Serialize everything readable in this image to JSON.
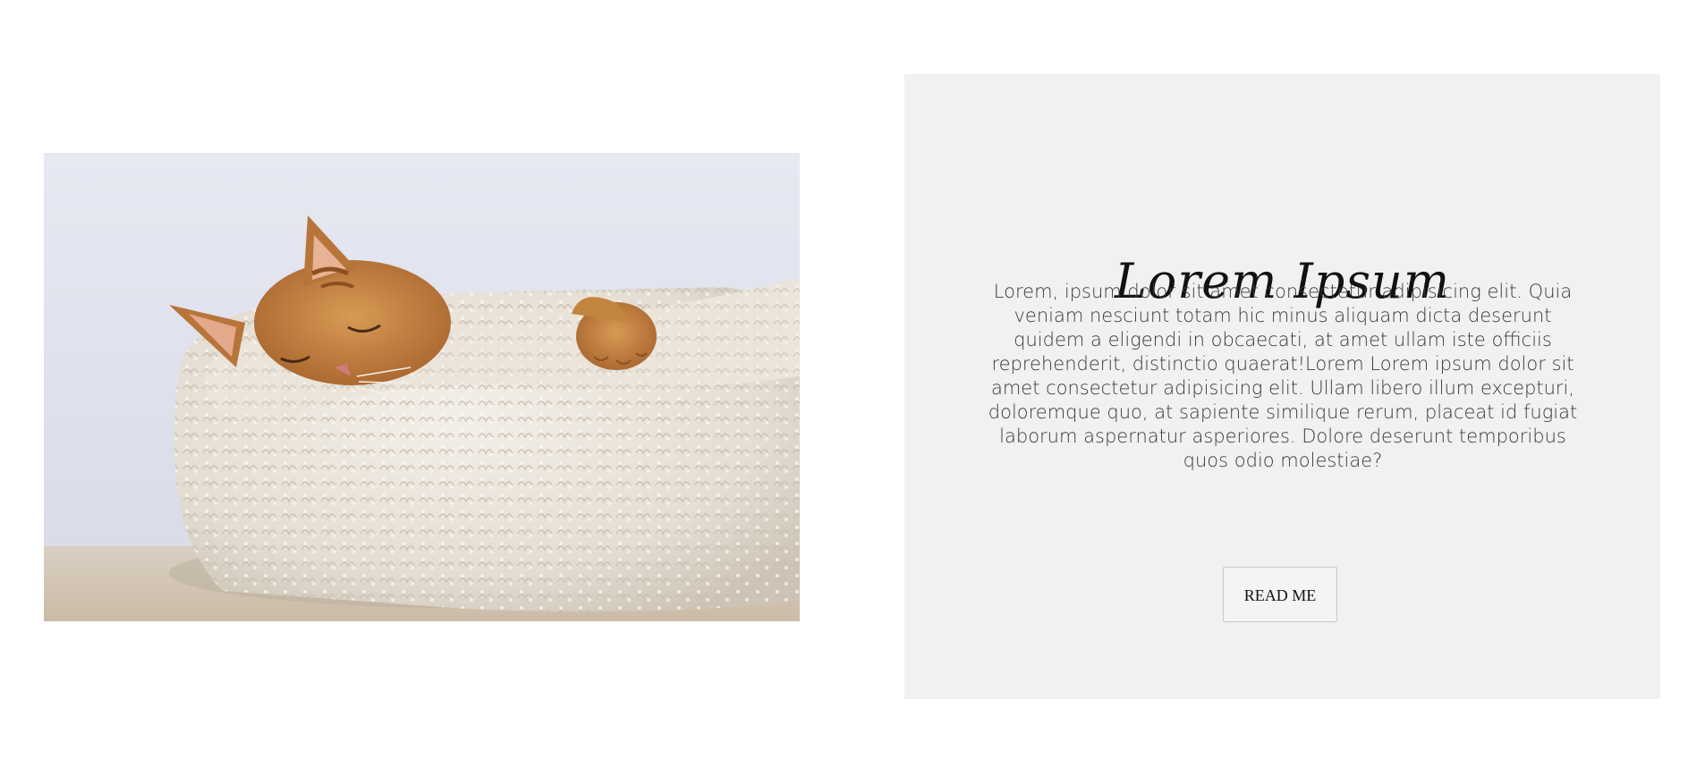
{
  "photo": {
    "subject": "Orange tabby cat sleeping in a white fluffy pet bed"
  },
  "card": {
    "title": "Lorem Ipsum",
    "body": "Lorem, ipsum dolor sit amet consectetur adipisicing elit. Quia veniam nesciunt totam hic minus aliquam dicta deserunt quidem a eligendi in obcaecati, at amet ullam iste officiis reprehenderit, distinctio quaerat!Lorem Lorem ipsum dolor sit amet consectetur adipisicing elit. Ullam libero illum excepturi, doloremque quo, at sapiente similique rerum, placeat id fugiat laborum aspernatur asperiores. Dolore deserunt temporibus quos odio molestiae?",
    "button_label": "READ ME"
  },
  "colors": {
    "card_background": "#f1f1f1",
    "page_background": "#ffffff",
    "text": "#3a3a3a",
    "title": "#111111"
  }
}
